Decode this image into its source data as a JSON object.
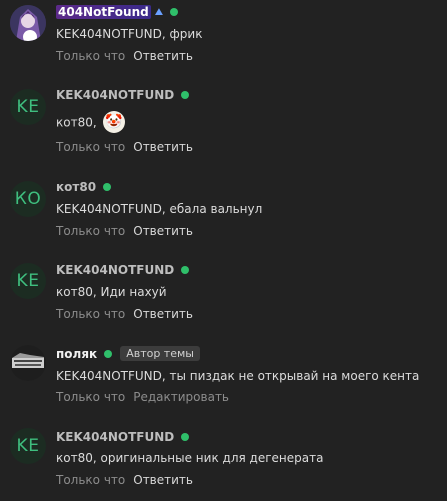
{
  "comments": [
    {
      "author": "404NotFound",
      "badge_icon": "gem-icon",
      "text_mention": "KEK404NOTFUND",
      "text_rest": ", фрик",
      "time": "Только что",
      "action": "Ответить"
    },
    {
      "author": "KEK404NOTFUND",
      "avatar_initials": "KE",
      "text_mention": "кот80",
      "text_rest": ",",
      "emoji": "clown-face-icon",
      "time": "Только что",
      "action": "Ответить"
    },
    {
      "author": "кот80",
      "avatar_initials": "КО",
      "text_mention": "KEK404NOTFUND",
      "text_rest": ", ебала вальнул",
      "time": "Только что",
      "action": "Ответить"
    },
    {
      "author": "KEK404NOTFUND",
      "avatar_initials": "KE",
      "text_mention": "кот80",
      "text_rest": ", Иди нахуй",
      "time": "Только что",
      "action": "Ответить"
    },
    {
      "author": "поляк",
      "author_badge": "Автор темы",
      "text_mention": "KEK404NOTFUND",
      "text_rest": ", ты пиздак не открывай на моего кента",
      "time": "Только что",
      "action": "Редактировать"
    },
    {
      "author": "KEK404NOTFUND",
      "avatar_initials": "KE",
      "text_mention": "кот80",
      "text_rest": ", оригинальные ник для дегенерата",
      "time": "Только что",
      "action": "Ответить"
    }
  ],
  "colors": {
    "background": "#222222",
    "online": "#2fbf6a",
    "avatar_text": "#3fbf7f"
  }
}
